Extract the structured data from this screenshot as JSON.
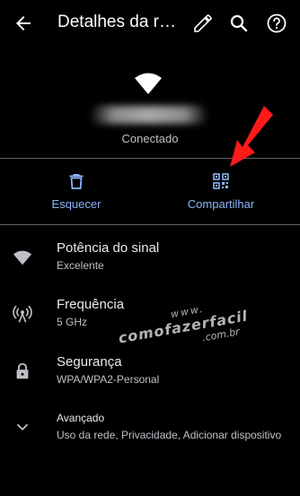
{
  "appbar": {
    "title": "Detalhes da rede",
    "back_icon": "arrow-left-icon",
    "edit_icon": "pencil-icon",
    "search_icon": "search-icon",
    "help_icon": "help-icon"
  },
  "network": {
    "icon": "wifi-icon",
    "status": "Conectado"
  },
  "actions": {
    "forget_label": "Esquecer",
    "share_label": "Compartilhar"
  },
  "details": [
    {
      "title": "Potência do sinal",
      "value": "Excelente",
      "icon": "wifi-icon"
    },
    {
      "title": "Frequência",
      "value": "5 GHz",
      "icon": "antenna-icon"
    },
    {
      "title": "Segurança",
      "value": "WPA/WPA2-Personal",
      "icon": "lock-icon"
    },
    {
      "title": "Avançado",
      "value": "Uso da rede, Privacidade, Adicionar dispositivo",
      "icon": "chevron-down-icon"
    }
  ],
  "watermark": {
    "line1": "www.",
    "line2": "comofazerfacil",
    "line3": ".com.br"
  },
  "colors": {
    "accent": "#8ab4f8",
    "arrow": "#ff1a1a",
    "background": "#000000"
  }
}
